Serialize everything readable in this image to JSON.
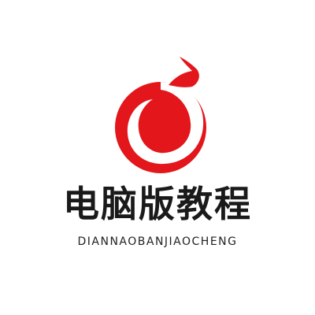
{
  "brand": {
    "title": "电脑版教程",
    "pinyin": "DIANNAOBANJIAOCHENG"
  },
  "logo": {
    "icon": "red-swirl-coin-icon",
    "primary_color": "#e3161b",
    "background_color": "#ffffff",
    "text_color": "#1a1a1a"
  }
}
